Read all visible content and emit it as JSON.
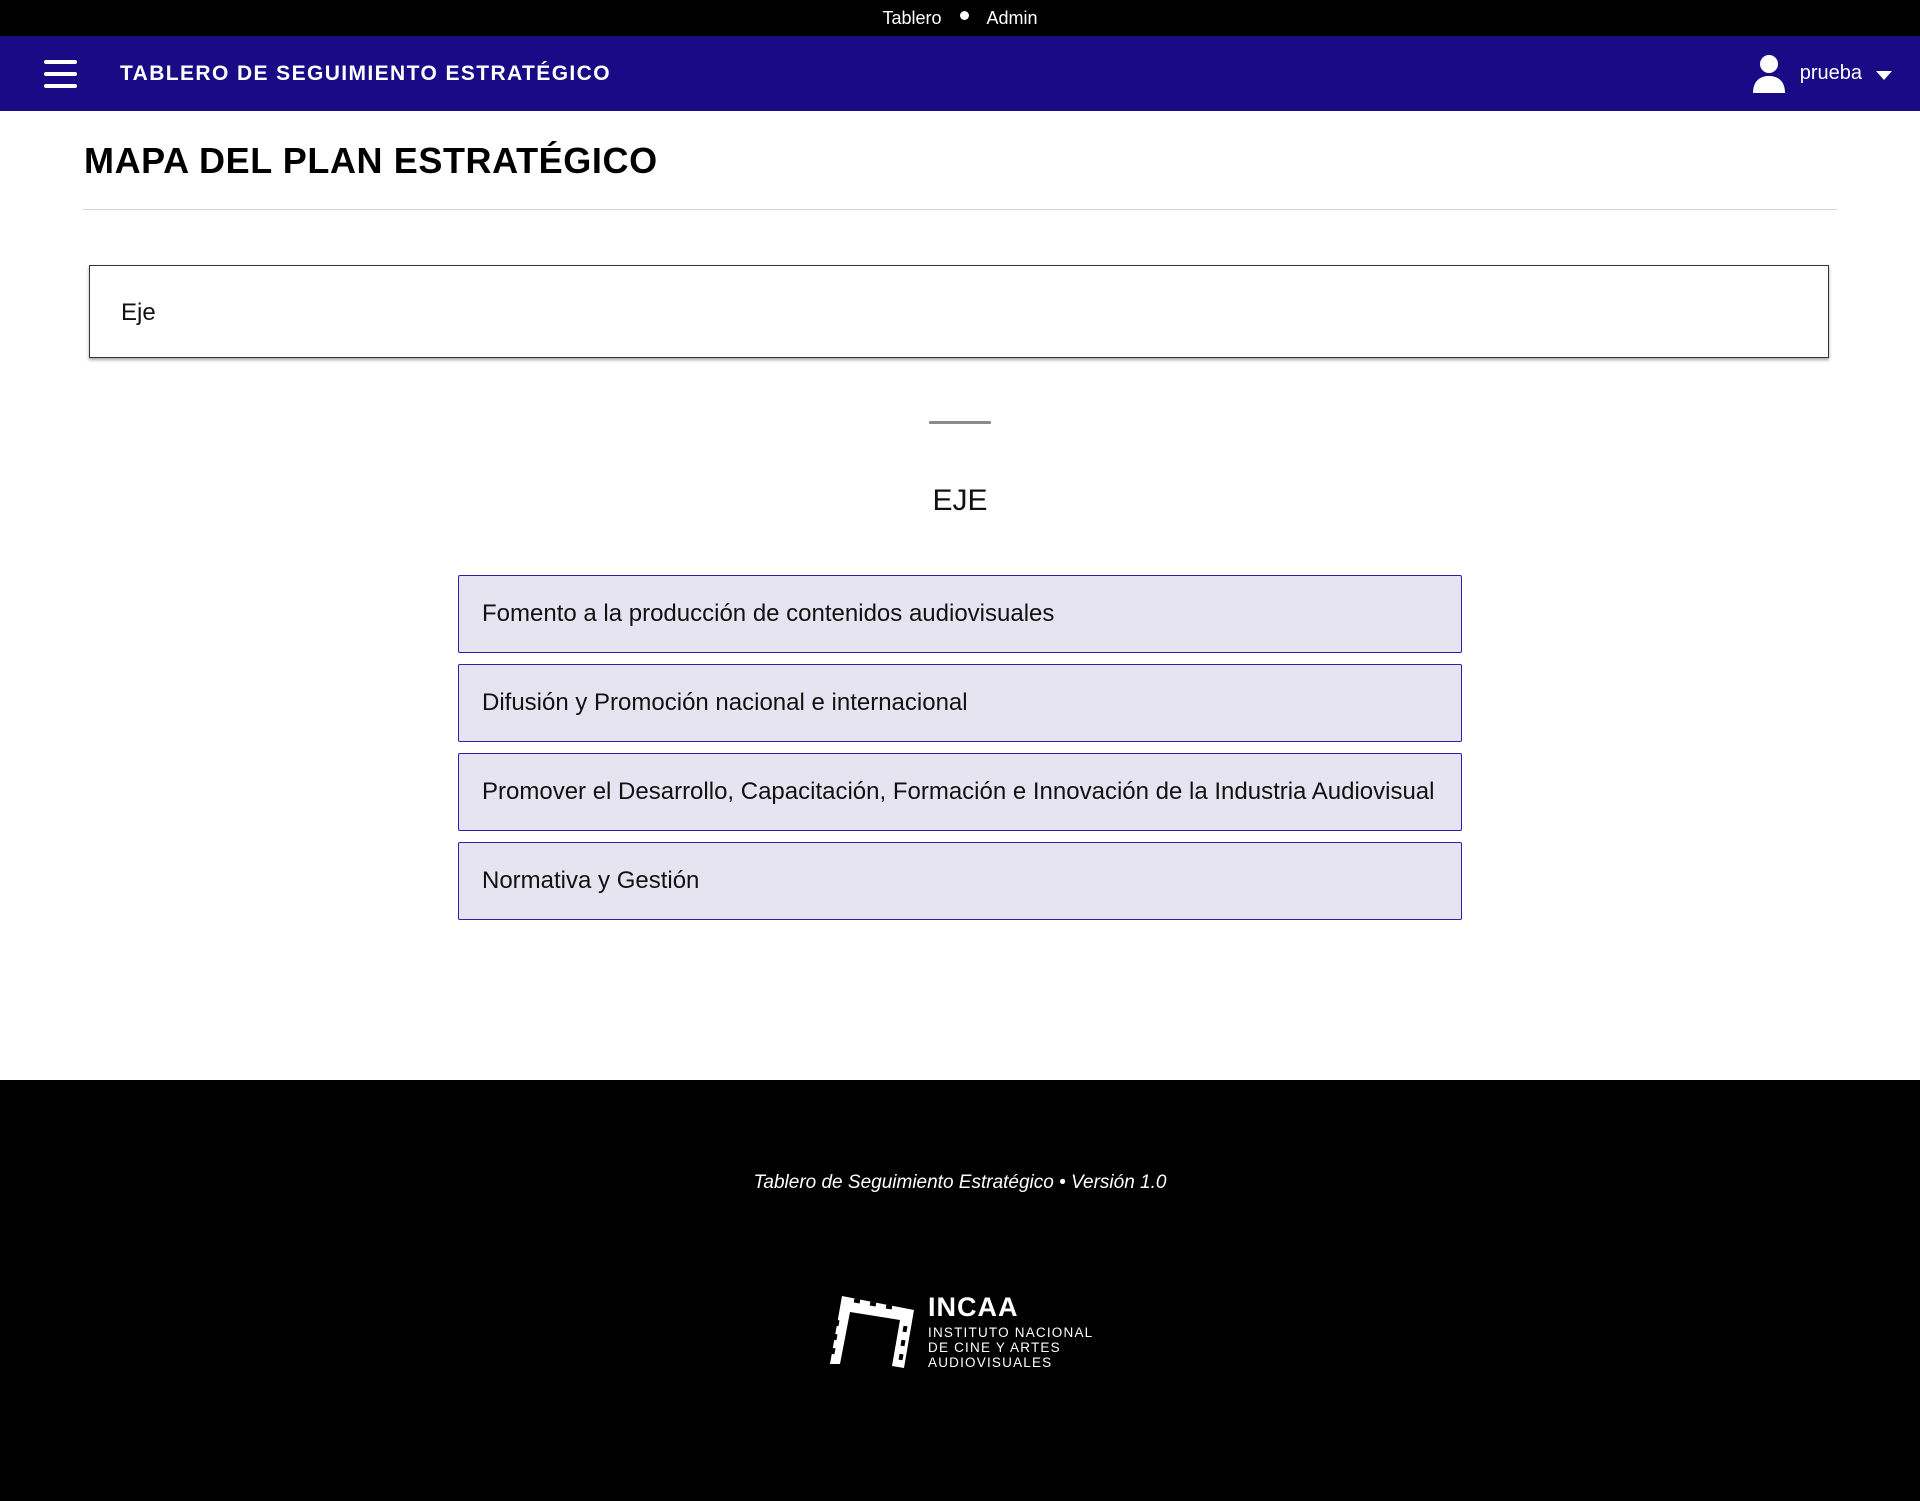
{
  "top_bar": {
    "links": [
      "Tablero",
      "Admin"
    ]
  },
  "navbar": {
    "title": "TABLERO DE SEGUIMIENTO ESTRATÉGICO",
    "user": "prueba",
    "background_color": "#1a0a85"
  },
  "page": {
    "title": "MAPA DEL PLAN ESTRATÉGICO",
    "eje_box_label": "Eje",
    "section_heading": "EJE"
  },
  "axes": [
    "Fomento a la producción de contenidos audiovisuales",
    "Difusión y Promoción nacional e internacional",
    "Promover el Desarrollo, Capacitación, Formación e Innovación de la Industria Audiovisual",
    "Normativa y Gestión"
  ],
  "footer": {
    "text": "Tablero de Seguimiento Estratégico • Versión 1.0",
    "logo": {
      "name": "INCAA",
      "lines": [
        "INSTITUTO NACIONAL",
        "DE CINE Y ARTES",
        "AUDIOVISUALES"
      ]
    }
  },
  "icons": {
    "menu": "hamburger-menu-icon",
    "user": "user-icon",
    "dropdown": "caret-down-icon",
    "logo": "film-strip-logo"
  }
}
